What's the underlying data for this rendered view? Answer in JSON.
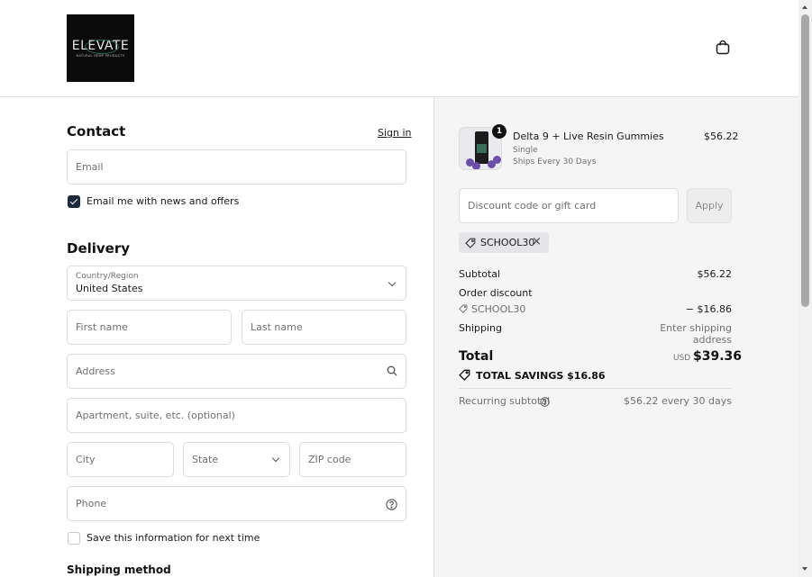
{
  "header": {
    "logo_text": "ELEVATE",
    "logo_subtext": "NATURAL HEMP PRODUCTS",
    "cart_icon": "shopping-bag-icon"
  },
  "contact": {
    "heading": "Contact",
    "sign_in_label": "Sign in",
    "email_placeholder": "Email",
    "news_checkbox_label": "Email me with news and offers",
    "news_checked": true
  },
  "delivery": {
    "heading": "Delivery",
    "country_label": "Country/Region",
    "country_value": "United States",
    "first_name_placeholder": "First name",
    "last_name_placeholder": "Last name",
    "address_placeholder": "Address",
    "apartment_placeholder": "Apartment, suite, etc. (optional)",
    "city_placeholder": "City",
    "state_placeholder": "State",
    "zip_placeholder": "ZIP code",
    "phone_placeholder": "Phone",
    "save_info_label": "Save this information for next time",
    "save_info_checked": false,
    "shipping_method_heading": "Shipping method"
  },
  "order": {
    "item": {
      "quantity": "1",
      "name": "Delta 9 + Live Resin Gummies",
      "variant": "Single",
      "subscription": "Ships Every 30 Days",
      "price": "$56.22"
    },
    "discount_placeholder": "Discount code or gift card",
    "apply_label": "Apply",
    "applied_code": "SCHOOL30",
    "subtotal_label": "Subtotal",
    "subtotal_value": "$56.22",
    "order_discount_label": "Order discount",
    "discount_code": "SCHOOL30",
    "discount_value": "− $16.86",
    "shipping_label": "Shipping",
    "shipping_value": "Enter shipping address",
    "total_label": "Total",
    "total_currency": "USD",
    "total_value": "$39.36",
    "savings_label": "TOTAL SAVINGS  $16.86",
    "recurring_label": "Recurring subtotal",
    "recurring_value": "$56.22 every 30 days"
  },
  "colors": {
    "checkbox_checked": "#1b2a3a",
    "summary_bg": "#f5f5f5",
    "muted_text": "#707070"
  }
}
